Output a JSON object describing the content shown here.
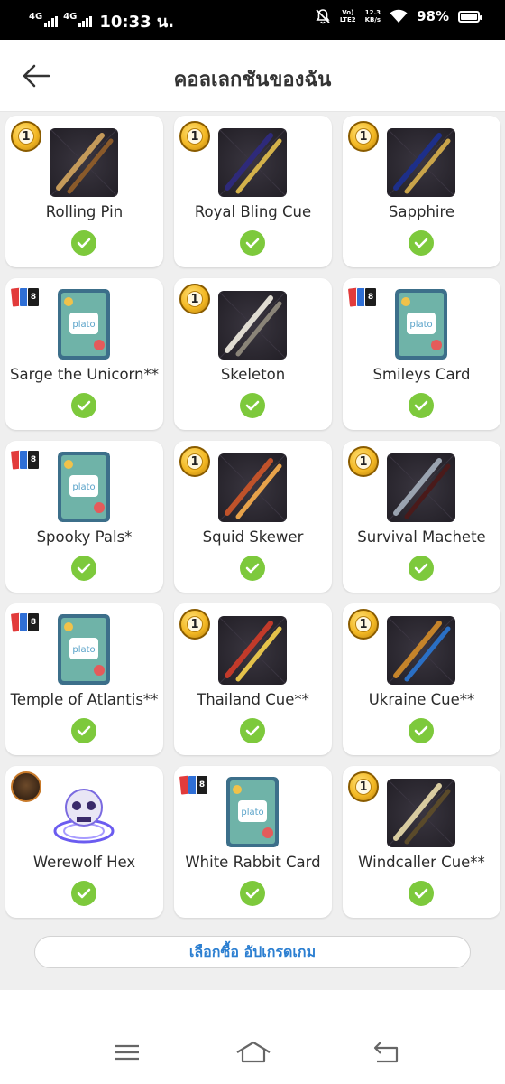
{
  "status_bar": {
    "network1": "4G",
    "network2": "4G",
    "time": "10:33 น.",
    "volte_line1": "Vo)",
    "volte_line2": "LTE2",
    "speed_value": "12.3",
    "speed_unit": "KB/s",
    "battery": "98%"
  },
  "header": {
    "title": "คอลเลกชันของฉัน"
  },
  "items": [
    {
      "name": "Rolling Pin",
      "badge": "coin",
      "badge_text": "1",
      "kind": "cue"
    },
    {
      "name": "Royal Bling Cue",
      "badge": "coin",
      "badge_text": "1",
      "kind": "cue"
    },
    {
      "name": "Sapphire",
      "badge": "coin",
      "badge_text": "1",
      "kind": "cue"
    },
    {
      "name": "Sarge the Unicorn**",
      "badge": "cards",
      "badge_text": "8",
      "kind": "card",
      "card_label": "plato"
    },
    {
      "name": "Skeleton",
      "badge": "coin",
      "badge_text": "1",
      "kind": "cue"
    },
    {
      "name": "Smileys Card",
      "badge": "cards",
      "badge_text": "8",
      "kind": "card",
      "card_label": "plato"
    },
    {
      "name": "Spooky Pals*",
      "badge": "cards",
      "badge_text": "8",
      "kind": "card",
      "card_label": "plato"
    },
    {
      "name": "Squid Skewer",
      "badge": "coin",
      "badge_text": "1",
      "kind": "cue"
    },
    {
      "name": "Survival Machete",
      "badge": "coin",
      "badge_text": "1",
      "kind": "cue"
    },
    {
      "name": "Temple of Atlantis**",
      "badge": "cards",
      "badge_text": "8",
      "kind": "card",
      "card_label": "plato"
    },
    {
      "name": "Thailand Cue**",
      "badge": "coin",
      "badge_text": "1",
      "kind": "cue"
    },
    {
      "name": "Ukraine Cue**",
      "badge": "coin",
      "badge_text": "1",
      "kind": "cue"
    },
    {
      "name": "Werewolf Hex",
      "badge": "wolf",
      "badge_text": "",
      "kind": "avatar"
    },
    {
      "name": "White Rabbit Card",
      "badge": "cards",
      "badge_text": "8",
      "kind": "card",
      "card_label": "plato"
    },
    {
      "name": "Windcaller Cue**",
      "badge": "coin",
      "badge_text": "1",
      "kind": "cue"
    }
  ],
  "upgrade_button": {
    "label": "เลือกซื้อ อัปเกรดเกม"
  },
  "colors": {
    "check_green": "#7dc93c",
    "link_blue": "#2c7fd1",
    "background": "#efefef"
  }
}
